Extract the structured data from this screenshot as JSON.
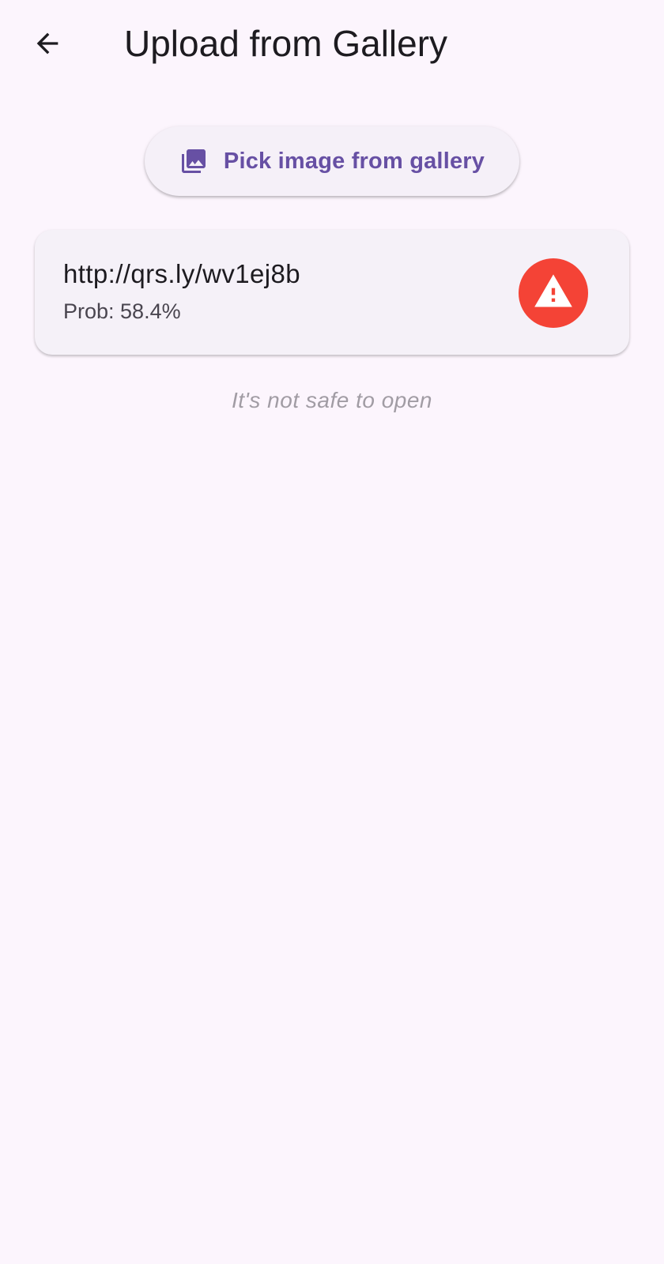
{
  "app_bar": {
    "title": "Upload from Gallery",
    "back_icon": "arrow-back-icon"
  },
  "pick_button": {
    "label": "Pick image from gallery",
    "icon": "photo-library-icon"
  },
  "result": {
    "url": "http://qrs.ly/wv1ej8b",
    "probability": "Prob: 58.4%",
    "status_icon": "warning-icon"
  },
  "status_message": "It's not safe to open",
  "colors": {
    "background": "#FCF5FD",
    "accent": "#6750A4",
    "danger": "#F44336",
    "muted_text": "#A19CA4"
  }
}
